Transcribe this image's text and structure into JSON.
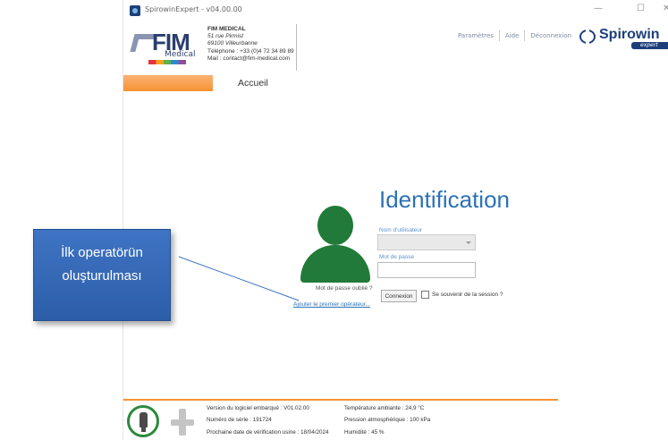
{
  "window": {
    "title": "SpirowinExpert - v04.00.00",
    "minimize": "—",
    "maximize": "☐",
    "close": "✕"
  },
  "contact": {
    "company": "FIM MEDICAL",
    "street": "51 rue Pirmist",
    "city": "69100 Villeurbanne",
    "phone": "Téléphone : +33 (0)4 72 34 89 89",
    "mail": "Mail : contact@fim-medical.com"
  },
  "logo": {
    "fim": "FIM",
    "medical": "Medical"
  },
  "top_nav": {
    "settings": "Paramètres",
    "help": "Aide",
    "logout": "Déconnexion"
  },
  "brand": {
    "name": "Spirowin",
    "tag": "expert"
  },
  "tab": {
    "label": "Accueil"
  },
  "login": {
    "title": "Identification",
    "username_label": "Nom d'utilisateur",
    "password_label": "Mot de passe",
    "forgot": "Mot de passe oublié ?",
    "add_operator": "Ajouter le premier opérateur...",
    "connect": "Connexion",
    "remember": "Se souvenir de la session ?"
  },
  "callout": {
    "line1": "İlk operatörün",
    "line2": "oluşturulması"
  },
  "footer": {
    "software": "Version du logiciel embarqué : V01.02.00",
    "serial": "Numéro de série : 191724",
    "next_check": "Prochaine date de vérification usine : 18/04/2024",
    "temperature": "Température ambiante : 24,9 °C",
    "pressure": "Pression atmosphérique : 100 kPa",
    "humidity": "Humidité : 45 %"
  },
  "colors": {
    "accent_orange": "#f79333",
    "title_blue": "#2c72b6",
    "avatar_green": "#217a3a",
    "callout_blue": "#3f74c4"
  }
}
